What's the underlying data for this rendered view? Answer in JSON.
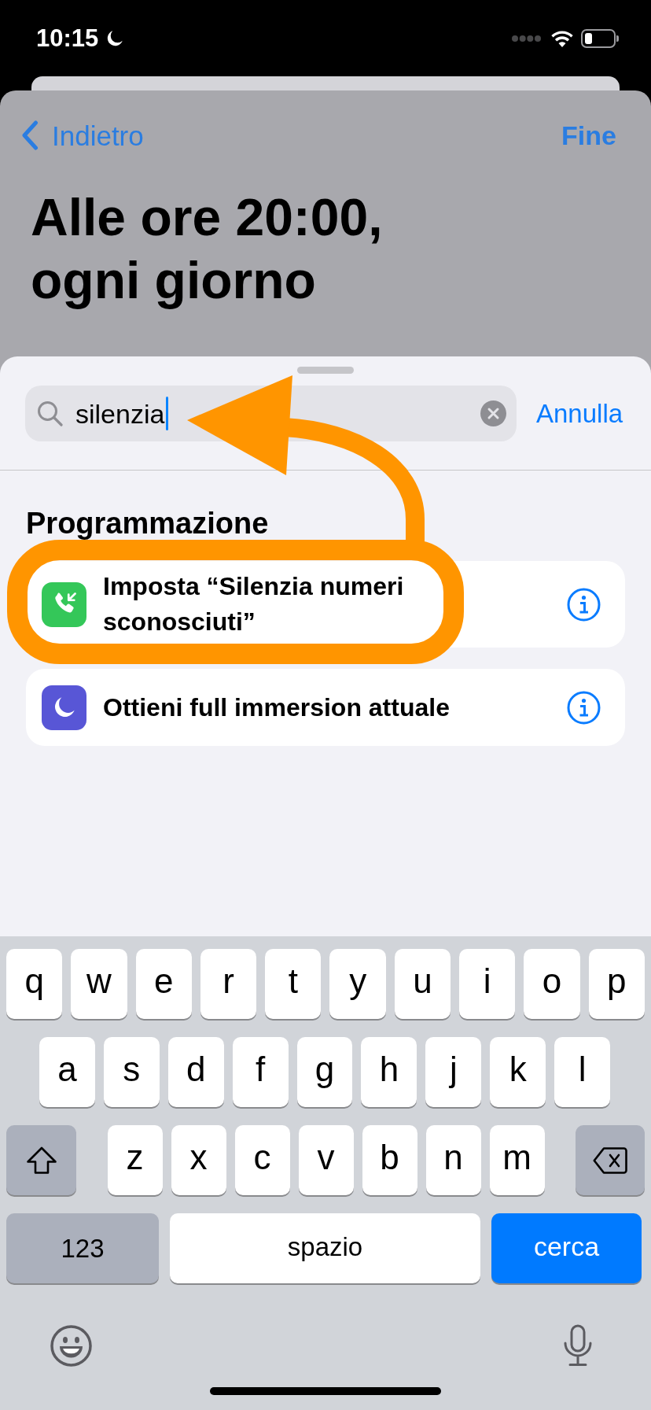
{
  "status_bar": {
    "time": "10:15"
  },
  "nav": {
    "back": "Indietro",
    "done": "Fine"
  },
  "title": "Alle ore 20:00, ogni giorno",
  "search": {
    "value": "silenzia",
    "cancel": "Annulla"
  },
  "section": {
    "title": "Programmazione",
    "items": [
      {
        "kind": "phone",
        "color": "#34c759",
        "label": "Imposta “Silenzia numeri sconosciuti”"
      },
      {
        "kind": "focus",
        "color": "#5856d6",
        "label": "Ottieni full immersion attuale"
      }
    ]
  },
  "keyboard": {
    "rows": [
      [
        "q",
        "w",
        "e",
        "r",
        "t",
        "y",
        "u",
        "i",
        "o",
        "p"
      ],
      [
        "a",
        "s",
        "d",
        "f",
        "g",
        "h",
        "j",
        "k",
        "l"
      ],
      [
        "z",
        "x",
        "c",
        "v",
        "b",
        "n",
        "m"
      ]
    ],
    "numbers_key": "123",
    "space_key": "spazio",
    "search_key": "cerca"
  }
}
